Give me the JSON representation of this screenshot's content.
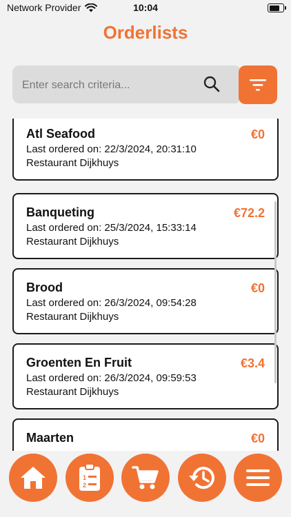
{
  "status_bar": {
    "carrier": "Network Provider",
    "time": "10:04",
    "battery_level": 0.9
  },
  "header": {
    "title": "Orderlists"
  },
  "search": {
    "placeholder": "Enter search criteria...",
    "value": ""
  },
  "orderlists": [
    {
      "name": "Atl Seafood",
      "price": "€0",
      "last_ordered": "Last ordered on: 22/3/2024, 20:31:10",
      "location": "Restaurant Dijkhuys"
    },
    {
      "name": "Banqueting",
      "price": "€72.2",
      "last_ordered": "Last ordered on: 25/3/2024, 15:33:14",
      "location": "Restaurant Dijkhuys"
    },
    {
      "name": "Brood",
      "price": "€0",
      "last_ordered": "Last ordered on: 26/3/2024, 09:54:28",
      "location": "Restaurant Dijkhuys"
    },
    {
      "name": "Groenten En Fruit",
      "price": "€3.4",
      "last_ordered": "Last ordered on: 26/3/2024, 09:59:53",
      "location": "Restaurant Dijkhuys"
    },
    {
      "name": "Maarten",
      "price": "€0",
      "last_ordered": "",
      "location": ""
    }
  ],
  "bottom_nav": {
    "items": [
      {
        "icon": "home-icon"
      },
      {
        "icon": "checklist-icon"
      },
      {
        "icon": "cart-icon"
      },
      {
        "icon": "history-icon"
      },
      {
        "icon": "menu-icon"
      }
    ]
  },
  "colors": {
    "accent": "#f07334",
    "background": "#f2f2f2",
    "card_border": "#1a1a1a"
  }
}
